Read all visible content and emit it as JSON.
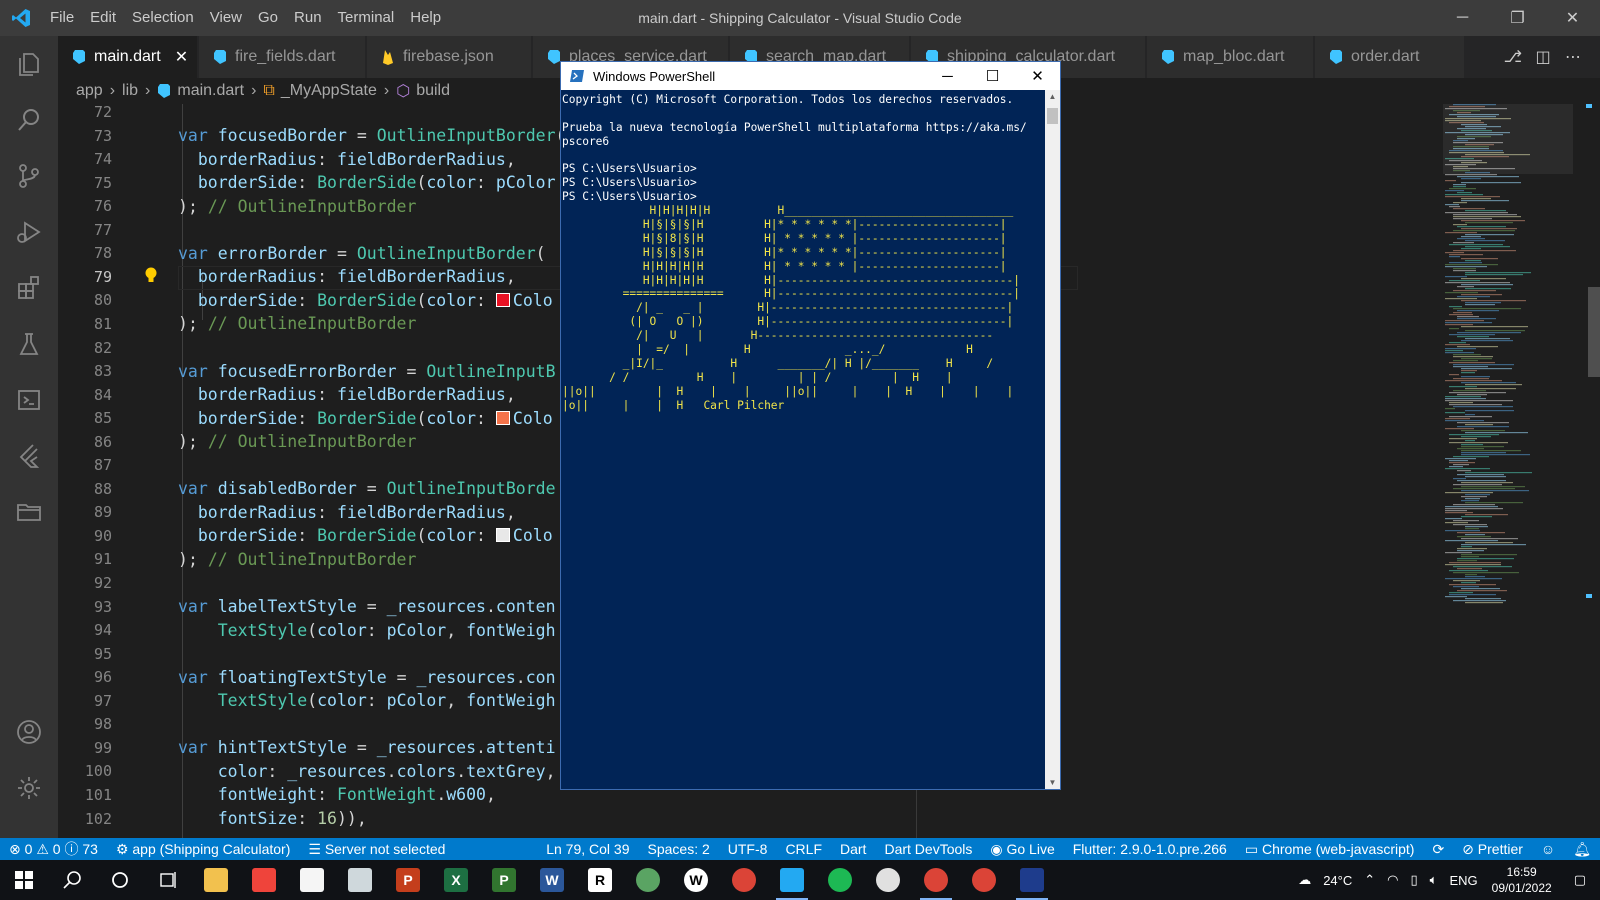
{
  "titlebar": {
    "menus": [
      "File",
      "Edit",
      "Selection",
      "View",
      "Go",
      "Run",
      "Terminal",
      "Help"
    ],
    "title": "main.dart - Shipping Calculator - Visual Studio Code",
    "controls": {
      "minimize": "─",
      "restore": "❐",
      "close": "✕"
    }
  },
  "activity_bar": [
    {
      "name": "explorer-icon"
    },
    {
      "name": "search-icon"
    },
    {
      "name": "source-control-icon"
    },
    {
      "name": "run-debug-icon"
    },
    {
      "name": "extensions-icon"
    },
    {
      "name": "testing-icon"
    },
    {
      "name": "remote-explorer-icon"
    },
    {
      "name": "flutter-icon"
    },
    {
      "name": "folder-icon"
    },
    {
      "name": "accounts-icon"
    },
    {
      "name": "settings-gear-icon"
    }
  ],
  "tabs": [
    {
      "label": "main.dart",
      "active": true,
      "close": "✕"
    },
    {
      "label": "fire_fields.dart"
    },
    {
      "label": "firebase.json"
    },
    {
      "label": "places_service.dart"
    },
    {
      "label": "search_map.dart"
    },
    {
      "label": "shipping_calculator.dart"
    },
    {
      "label": "map_bloc.dart"
    },
    {
      "label": "order.dart"
    }
  ],
  "breadcrumb": [
    "app",
    "lib",
    "main.dart",
    "_MyAppState",
    "build"
  ],
  "editor": {
    "current_line": 79,
    "swatch_colors": {
      "80": "#e81123",
      "85": "#f4734a",
      "90": "#e8e8e8"
    },
    "lines": [
      {
        "n": "72",
        "code": ""
      },
      {
        "n": "73",
        "code": "var focusedBorder = OutlineInputBorder("
      },
      {
        "n": "74",
        "code": "  borderRadius: fieldBorderRadius,"
      },
      {
        "n": "75",
        "code": "  borderSide: BorderSide(color: pColor"
      },
      {
        "n": "76",
        "code": "); // OutlineInputBorder"
      },
      {
        "n": "77",
        "code": ""
      },
      {
        "n": "78",
        "code": "var errorBorder = OutlineInputBorder("
      },
      {
        "n": "79",
        "code": "  borderRadius: fieldBorderRadius,"
      },
      {
        "n": "80",
        "code": "  borderSide: BorderSide(color: Colo"
      },
      {
        "n": "81",
        "code": "); // OutlineInputBorder"
      },
      {
        "n": "82",
        "code": ""
      },
      {
        "n": "83",
        "code": "var focusedErrorBorder = OutlineInputB"
      },
      {
        "n": "84",
        "code": "  borderRadius: fieldBorderRadius,"
      },
      {
        "n": "85",
        "code": "  borderSide: BorderSide(color: Colo"
      },
      {
        "n": "86",
        "code": "); // OutlineInputBorder"
      },
      {
        "n": "87",
        "code": ""
      },
      {
        "n": "88",
        "code": "var disabledBorder = OutlineInputBorde"
      },
      {
        "n": "89",
        "code": "  borderRadius: fieldBorderRadius,"
      },
      {
        "n": "90",
        "code": "  borderSide: BorderSide(color: Colo"
      },
      {
        "n": "91",
        "code": "); // OutlineInputBorder"
      },
      {
        "n": "92",
        "code": ""
      },
      {
        "n": "93",
        "code": "var labelTextStyle = _resources.conten"
      },
      {
        "n": "94",
        "code": "    TextStyle(color: pColor, fontWeigh"
      },
      {
        "n": "95",
        "code": ""
      },
      {
        "n": "96",
        "code": "var floatingTextStyle = _resources.con"
      },
      {
        "n": "97",
        "code": "    TextStyle(color: pColor, fontWeigh"
      },
      {
        "n": "98",
        "code": ""
      },
      {
        "n": "99",
        "code": "var hintTextStyle = _resources.attenti"
      },
      {
        "n": "100",
        "code": "    color: _resources.colors.textGrey,"
      },
      {
        "n": "101",
        "code": "    fontWeight: FontWeight.w600,"
      },
      {
        "n": "102",
        "code": "    fontSize: 16)),"
      }
    ]
  },
  "statusbar": {
    "errors": "0",
    "warnings": "0",
    "info": "73",
    "left": [
      "app (Shipping Calculator)",
      "Server not selected"
    ],
    "right": [
      "Ln 79, Col 39",
      "Spaces: 2",
      "UTF-8",
      "CRLF",
      "Dart",
      "Dart DevTools",
      "Go Live",
      "Flutter: 2.9.0-1.0.pre.266",
      "Chrome (web-javascript)",
      "Prettier"
    ]
  },
  "powershell": {
    "title": "Windows PowerShell",
    "lines": [
      "Copyright (C) Microsoft Corporation. Todos los derechos reservados.",
      "",
      "Prueba la nueva tecnología PowerShell multiplataforma https://aka.ms/",
      "pscore6",
      "",
      "PS C:\\Users\\Usuario>",
      "PS C:\\Users\\Usuario>",
      "PS C:\\Users\\Usuario>"
    ],
    "art": [
      "             H|H|H|H|H          H__________________________________",
      "            H|§|§|§|H         H|* * * * * *|---------------------|",
      "            H|§|8|§|H         H| * * * * * |---------------------|",
      "            H|§|§|§|H         H|* * * * * *|---------------------|",
      "            H|H|H|H|H         H| * * * * * |---------------------|",
      "            H|H|H|H|H         H|-----------------------------------|",
      "         ===============      H|-----------------------------------|",
      "           /| _   _ |        H|-----------------------------------|",
      "          (| O   O |)        H|-----------------------------------|",
      "           /|   U   |       H-----------------------------------",
      "           |  =/  |        H              _..._/            H",
      "         _|I/|_          H      _______/| H |/_______    H     /",
      "       / /          H    |         | | /         |  H    |",
      "||o||         |  H    |    |     ||o||     |    |  H    |    |    |",
      "|o||     |    |  H   Carl Pilcher"
    ]
  },
  "taskbar": {
    "apps": [
      {
        "name": "start-icon"
      },
      {
        "name": "search-icon"
      },
      {
        "name": "cortana-icon"
      },
      {
        "name": "task-view-icon"
      },
      {
        "name": "file-explorer-icon",
        "color": "#f2c14e"
      },
      {
        "name": "anydesk-icon",
        "color": "#ef443b"
      },
      {
        "name": "store-icon",
        "color": "#f5f5f5"
      },
      {
        "name": "camera-icon",
        "color": "#cfd8dc"
      },
      {
        "name": "powerpoint-icon",
        "color": "#c43e1c",
        "label": "P"
      },
      {
        "name": "excel-icon",
        "color": "#1d6f42",
        "label": "X"
      },
      {
        "name": "project-icon",
        "color": "#31752f",
        "label": "P"
      },
      {
        "name": "word-icon",
        "color": "#2b579a",
        "label": "W"
      },
      {
        "name": "rstudio-icon",
        "color": "#ffffff",
        "label": "R"
      },
      {
        "name": "telegram-icon",
        "color": "#5aa463"
      },
      {
        "name": "wordpress-icon",
        "color": "#ffffff",
        "label": "W"
      },
      {
        "name": "chrome-icon",
        "color": "#db4437"
      },
      {
        "name": "vscode-icon",
        "color": "#23a9f2",
        "active": true
      },
      {
        "name": "spotify-icon",
        "color": "#1db954"
      },
      {
        "name": "clock-app-icon",
        "color": "#e0e0e0"
      },
      {
        "name": "chrome-profile-icon",
        "color": "#db4437",
        "active": true
      },
      {
        "name": "chrome-beta-icon",
        "color": "#db4437"
      },
      {
        "name": "powershell-icon",
        "color": "#1e3c8c",
        "active": true
      }
    ],
    "weather": "24°C",
    "language": "ENG",
    "time": "16:59",
    "date": "09/01/2022"
  }
}
